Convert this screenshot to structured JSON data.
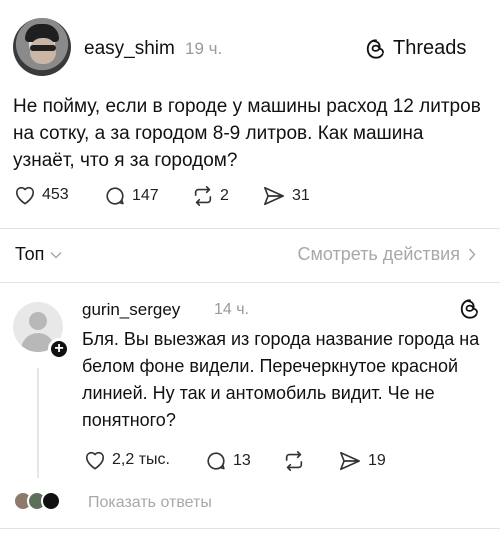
{
  "post": {
    "username": "easy_shim",
    "time": "19 ч.",
    "brand": "Threads",
    "text": "Не пойму, если в городе у машины расход 12 литров на сотку, а за городом 8-9 литров. Как машина узнаёт, что я за городом?",
    "likes": "453",
    "comments": "147",
    "reposts": "2",
    "shares": "31"
  },
  "sortbar": {
    "sort_label": "Топ",
    "activity_label": "Смотреть действия"
  },
  "reply": {
    "username": "gurin_sergey",
    "time": "14 ч.",
    "text": "Бля. Вы выезжая из города название города на белом фоне видели. Перечеркнутое красной линией. Ну так и антомобиль видит. Че не понятного?",
    "likes": "2,2 тыс.",
    "comments": "13",
    "shares": "19",
    "show_replies": "Показать ответы"
  },
  "icons": {
    "like": "heart-icon",
    "comment": "comment-bubble-icon",
    "repost": "repost-arrows-icon",
    "share": "send-arrow-icon",
    "threads": "threads-logo-icon",
    "chevron_down": "chevron-down-icon",
    "chevron_right": "chevron-right-icon",
    "follow": "plus-icon"
  },
  "colors": {
    "text": "#111111",
    "muted": "#9a9a9a",
    "divider": "#e3e3e3"
  }
}
